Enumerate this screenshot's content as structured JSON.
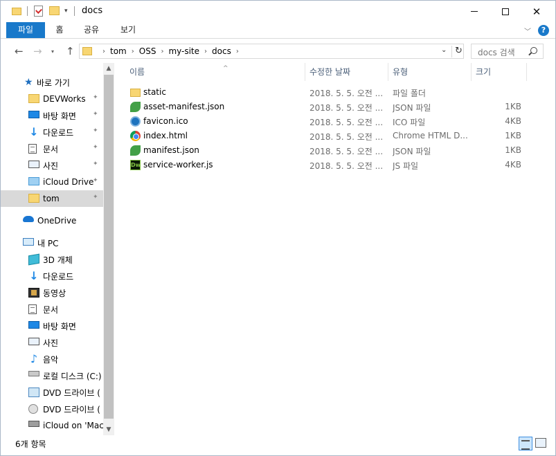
{
  "window": {
    "title": "docs",
    "min_glyph": "",
    "close_glyph": "✕"
  },
  "ribbon": {
    "tabs": [
      "파일",
      "홈",
      "공유",
      "보기"
    ],
    "expand_glyph": "﹀",
    "help_glyph": "?"
  },
  "nav": {
    "back_glyph": "←",
    "forward_glyph": "→",
    "recent_glyph": "▾",
    "up_glyph": "↑",
    "breadcrumbs": [
      "tom",
      "OSS",
      "my-site",
      "docs"
    ],
    "crumb_sep": "›",
    "dropdown_glyph": "⌄",
    "refresh_glyph": "↻",
    "search_placeholder": "docs 검색"
  },
  "sidebar": {
    "items": [
      {
        "label": "바로 가기",
        "icon": "star-icon",
        "pinned": false
      },
      {
        "label": "DEVWorks",
        "icon": "folder-icon",
        "pinned": true
      },
      {
        "label": "바탕 화면",
        "icon": "desktop-icon",
        "pinned": true
      },
      {
        "label": "다운로드",
        "icon": "download-icon",
        "pinned": true
      },
      {
        "label": "문서",
        "icon": "document-icon",
        "pinned": true
      },
      {
        "label": "사진",
        "icon": "pictures-icon",
        "pinned": true
      },
      {
        "label": "iCloud Drive",
        "icon": "icloud-drive-icon",
        "pinned": true
      },
      {
        "label": "tom",
        "icon": "folder-icon",
        "pinned": true,
        "selected": true
      },
      {
        "label": "OneDrive",
        "icon": "onedrive-icon",
        "pinned": false
      },
      {
        "label": "내 PC",
        "icon": "pc-icon",
        "pinned": false
      },
      {
        "label": "3D 개체",
        "icon": "3d-objects-icon",
        "pinned": false
      },
      {
        "label": "다운로드",
        "icon": "download-icon",
        "pinned": false
      },
      {
        "label": "동영상",
        "icon": "video-icon",
        "pinned": false
      },
      {
        "label": "문서",
        "icon": "document-icon",
        "pinned": false
      },
      {
        "label": "바탕 화면",
        "icon": "desktop-icon",
        "pinned": false
      },
      {
        "label": "사진",
        "icon": "pictures-icon",
        "pinned": false
      },
      {
        "label": "음악",
        "icon": "music-icon",
        "pinned": false
      },
      {
        "label": "로컬 디스크 (C:)",
        "icon": "local-disk-icon",
        "pinned": false
      },
      {
        "label": "DVD 드라이브 (",
        "icon": "dvd-drive-icon",
        "pinned": false
      },
      {
        "label": "DVD 드라이브 (",
        "icon": "dvd-disc-icon",
        "pinned": false
      },
      {
        "label": "iCloud on 'Mac'",
        "icon": "network-drive-icon",
        "pinned": false
      }
    ],
    "pin_glyph": "📌"
  },
  "scrollbar": {
    "up_glyph": "▲",
    "down_glyph": "▼"
  },
  "columns": {
    "name": "이름",
    "date": "수정한 날짜",
    "type": "유형",
    "size": "크기",
    "sort_glyph": "^"
  },
  "files": [
    {
      "name": "static",
      "date": "2018. 5. 5. 오전 ...",
      "type": "파일 폴더",
      "size": "",
      "icon": "folder-icon"
    },
    {
      "name": "asset-manifest.json",
      "date": "2018. 5. 5. 오전 ...",
      "type": "JSON 파일",
      "size": "1KB",
      "icon": "json-file-icon"
    },
    {
      "name": "favicon.ico",
      "date": "2018. 5. 5. 오전 ...",
      "type": "ICO 파일",
      "size": "4KB",
      "icon": "ico-file-icon"
    },
    {
      "name": "index.html",
      "date": "2018. 5. 5. 오전 ...",
      "type": "Chrome HTML D...",
      "size": "1KB",
      "icon": "chrome-html-icon"
    },
    {
      "name": "manifest.json",
      "date": "2018. 5. 5. 오전 ...",
      "type": "JSON 파일",
      "size": "1KB",
      "icon": "json-file-icon"
    },
    {
      "name": "service-worker.js",
      "date": "2018. 5. 5. 오전 ...",
      "type": "JS 파일",
      "size": "4KB",
      "icon": "dreamweaver-js-icon"
    }
  ],
  "dw_badge": "Dw",
  "status": {
    "item_count": "6개 항목"
  },
  "colors": {
    "accent": "#1979ca",
    "folder": "#f8d673",
    "selection": "#d9d9d9"
  }
}
